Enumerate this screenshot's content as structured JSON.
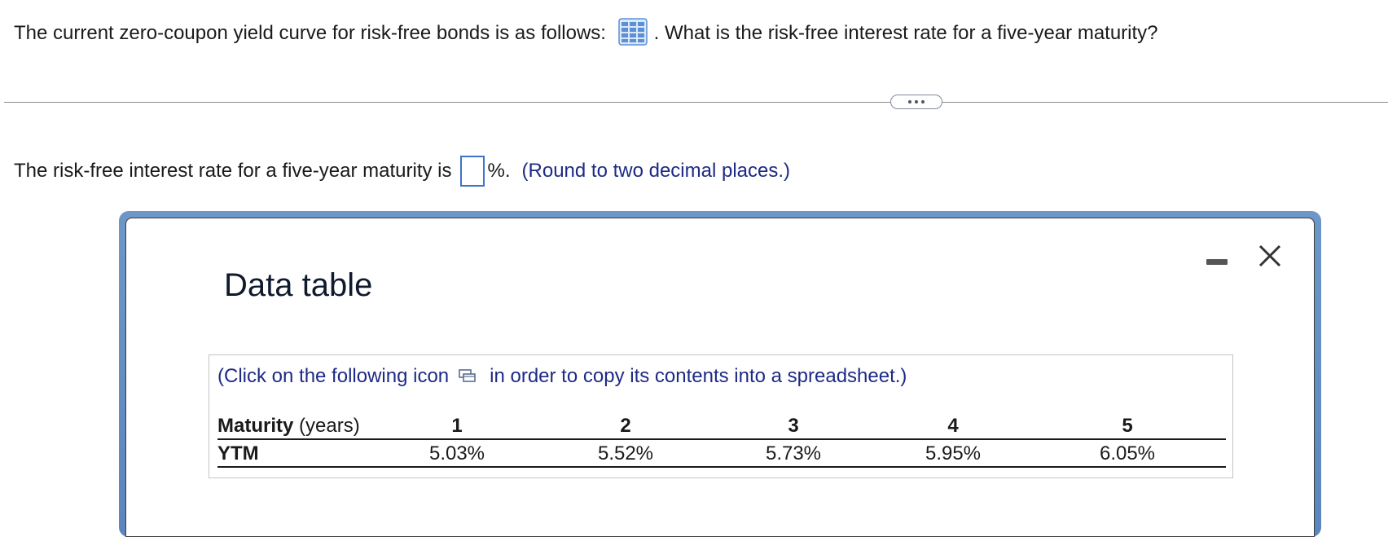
{
  "question": {
    "text_before": "The current zero-coupon yield curve for risk-free bonds is as follows:",
    "text_after": ". What is the risk-free interest rate for a five-year maturity?"
  },
  "answer": {
    "prefix": "The risk-free interest rate for a five-year maturity is",
    "suffix": "%.",
    "hint": "(Round to two decimal places.)",
    "value": ""
  },
  "popup": {
    "title": "Data table",
    "copy_note_before": "(Click on the following icon",
    "copy_note_after": "in order to copy its contents into a spreadsheet.)",
    "table": {
      "header_label_bold": "Maturity",
      "header_label_rest": " (years)",
      "row_label": "YTM",
      "maturities": [
        "1",
        "2",
        "3",
        "4",
        "5"
      ],
      "ytm": [
        "5.03%",
        "5.52%",
        "5.73%",
        "5.95%",
        "6.05%"
      ]
    }
  },
  "colors": {
    "accent_blue": "#3b73c7",
    "hint_navy": "#1d2a86",
    "popup_frame": "#5a86bd"
  },
  "icons": {
    "table_icon": "grid-table-icon",
    "more_icon": "ellipsis-icon",
    "copy_icon": "copy-to-spreadsheet-icon",
    "minimize_icon": "minimize-icon",
    "close_icon": "close-x-icon"
  }
}
